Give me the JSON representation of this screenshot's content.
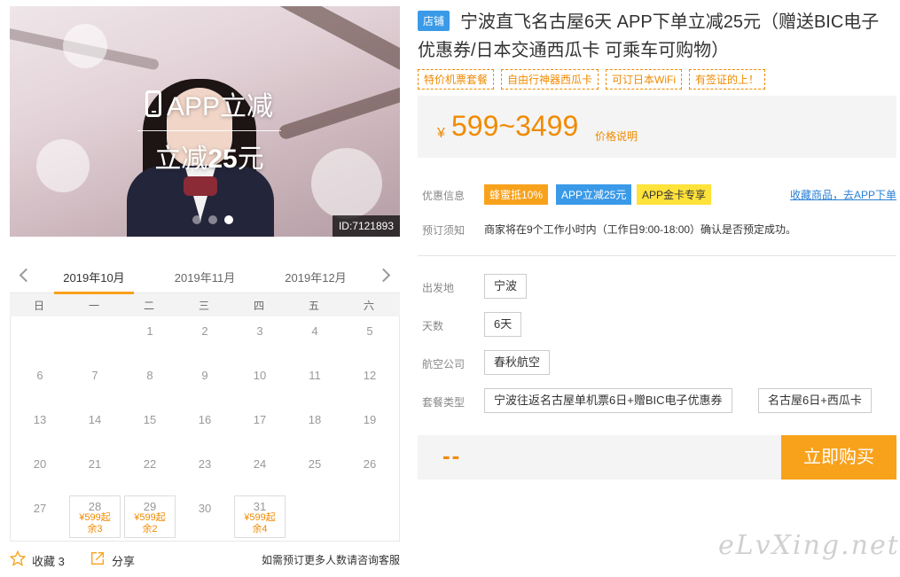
{
  "gallery": {
    "promo_line1": "APP立减",
    "promo_line2_prefix": "立减",
    "promo_line2_amount": "25",
    "promo_line2_suffix": "元",
    "product_id": "ID:7121893",
    "slide_count": 3,
    "active_slide": 3
  },
  "calendar": {
    "months": [
      "2019年10月",
      "2019年11月",
      "2019年12月"
    ],
    "active_month": 0,
    "weekdays": [
      "日",
      "一",
      "二",
      "三",
      "四",
      "五",
      "六"
    ],
    "days": [
      {
        "day": "1"
      },
      {
        "day": "2"
      },
      {
        "day": "3"
      },
      {
        "day": "4"
      },
      {
        "day": "5"
      },
      {
        "day": "6"
      },
      {
        "day": "7"
      },
      {
        "day": "8"
      },
      {
        "day": "9"
      },
      {
        "day": "10"
      },
      {
        "day": "11"
      },
      {
        "day": "12"
      },
      {
        "day": "13"
      },
      {
        "day": "14"
      },
      {
        "day": "15"
      },
      {
        "day": "16"
      },
      {
        "day": "17"
      },
      {
        "day": "18"
      },
      {
        "day": "19"
      },
      {
        "day": "20"
      },
      {
        "day": "21"
      },
      {
        "day": "22"
      },
      {
        "day": "23"
      },
      {
        "day": "24"
      },
      {
        "day": "25"
      },
      {
        "day": "26"
      },
      {
        "day": "27"
      },
      {
        "day": "28",
        "price": "¥599起",
        "remain": "余3"
      },
      {
        "day": "29",
        "price": "¥599起",
        "remain": "余2"
      },
      {
        "day": "30"
      },
      {
        "day": "31",
        "price": "¥599起",
        "remain": "余4"
      }
    ],
    "first_weekday": 2
  },
  "footer": {
    "favorite_label": "收藏",
    "favorite_count": "3",
    "share_label": "分享",
    "consult_note": "如需预订更多人数请咨询客服"
  },
  "product": {
    "shop_tag": "店铺",
    "title": "宁波直飞名古屋6天 APP下单立减25元（赠送BIC电子优惠券/日本交通西瓜卡 可乘车可购物）",
    "feature_tags": [
      "特价机票套餐",
      "自由行神器西瓜卡",
      "可订日本WiFi",
      "有签证的上！"
    ],
    "price_currency": "¥",
    "price_range": "599~3499",
    "price_note": "价格说明"
  },
  "offers": {
    "label": "优惠信息",
    "tags": [
      "蜂蜜抵10%",
      "APP立减25元",
      "APP金卡专享"
    ],
    "app_link": "收藏商品，去APP下单"
  },
  "booking_notice": {
    "label": "预订须知",
    "text": "商家将在9个工作小时内（工作日9:00-18:00）确认是否预定成功。"
  },
  "options": {
    "departure_label": "出发地",
    "departure_value": "宁波",
    "days_label": "天数",
    "days_value": "6天",
    "airline_label": "航空公司",
    "airline_value": "春秋航空",
    "package_label": "套餐类型",
    "package_values": [
      "宁波往返名古屋单机票6日+赠BIC电子优惠券",
      "名古屋6日+西瓜卡"
    ]
  },
  "purchase": {
    "total_placeholder": "--",
    "buy_label": "立即购买"
  },
  "watermark": "eLvXing.net",
  "colors": {
    "accent_orange": "#f8a21c",
    "price_orange": "#f08a00",
    "blue": "#3a9ae8",
    "yellow": "#ffe23a"
  }
}
